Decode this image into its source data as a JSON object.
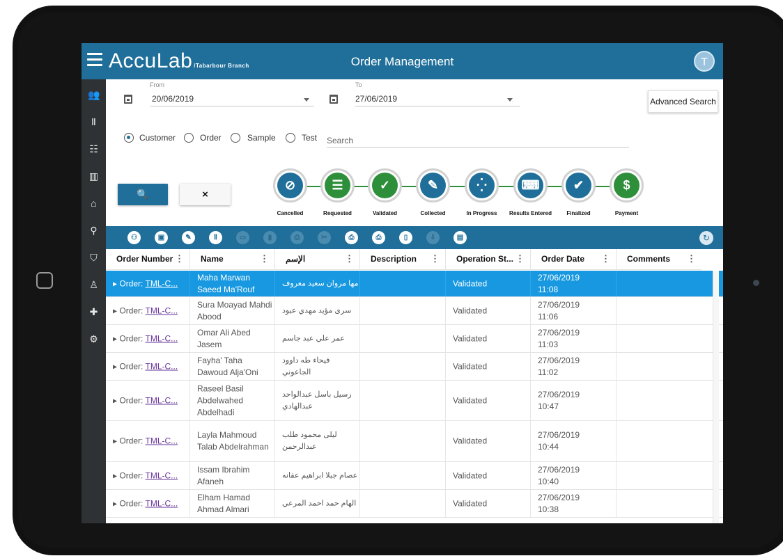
{
  "app": {
    "logo": "AccuLab",
    "branch": "/Tabarbour Branch",
    "title": "Order Management",
    "user_initial": "T"
  },
  "sidebar": {
    "items": [
      "users-icon",
      "tubes-icon",
      "list-icon",
      "chart-icon",
      "bank-icon",
      "microscope-icon",
      "shield-icon",
      "doctor-icon",
      "medkit-icon",
      "gear-icon"
    ]
  },
  "filters": {
    "from_label": "From",
    "from_value": "20/06/2019",
    "to_label": "To",
    "to_value": "27/06/2019",
    "advanced_search": "Advanced Search",
    "radio_options": [
      "Customer",
      "Order",
      "Sample",
      "Test"
    ],
    "selected_radio": "Customer",
    "search_placeholder": "Search",
    "search_button": "🔍",
    "clear_button": "×"
  },
  "statuses": [
    {
      "label": "Cancelled",
      "color": "#1f6f9a",
      "icon": "⊘"
    },
    {
      "label": "Requested",
      "color": "#2e8f3a",
      "icon": "☰"
    },
    {
      "label": "Validated",
      "color": "#2e8f3a",
      "icon": "✓"
    },
    {
      "label": "Collected",
      "color": "#1f6f9a",
      "icon": "✎"
    },
    {
      "label": "In Progress",
      "color": "#1f6f9a",
      "icon": "⁛"
    },
    {
      "label": "Results Entered",
      "color": "#1f6f9a",
      "icon": "⌨"
    },
    {
      "label": "Finalized",
      "color": "#1f6f9a",
      "icon": "✔"
    },
    {
      "label": "Payment",
      "color": "#2e8f3a",
      "icon": "$"
    }
  ],
  "table": {
    "columns": [
      "Order Number",
      "Name",
      "الإسم",
      "Description",
      "Operation St...",
      "Order Date",
      "Comments"
    ],
    "rows": [
      {
        "order_prefix": "Order:",
        "order_link": "TML-C...",
        "name": "Maha Marwan Saeed Ma'Rouf",
        "arabic": "مها مروان سعيد معروف",
        "description": "",
        "status": "Validated",
        "date": "27/06/2019",
        "time": "11:08",
        "comments": "",
        "selected": true
      },
      {
        "order_prefix": "Order:",
        "order_link": "TML-C...",
        "name": "Sura Moayad Mahdi Abood",
        "arabic": "سرى مؤيد مهدي عبود",
        "description": "",
        "status": "Validated",
        "date": "27/06/2019",
        "time": "11:06",
        "comments": "",
        "selected": false
      },
      {
        "order_prefix": "Order:",
        "order_link": "TML-C...",
        "name": "Omar Ali Abed Jasem",
        "arabic": "عمر علي عبد جاسم",
        "description": "",
        "status": "Validated",
        "date": "27/06/2019",
        "time": "11:03",
        "comments": "",
        "selected": false
      },
      {
        "order_prefix": "Order:",
        "order_link": "TML-C...",
        "name": "Fayha' Taha Dawoud Alja'Oni",
        "arabic": "فيحاء طه داوود الجاعوني",
        "description": "",
        "status": "Validated",
        "date": "27/06/2019",
        "time": "11:02",
        "comments": "",
        "selected": false
      },
      {
        "order_prefix": "Order:",
        "order_link": "TML-C...",
        "name": "Raseel Basil Abdelwahed Abdelhadi",
        "arabic": "رسيل باسل عبدالواحد عبدالهادي",
        "description": "",
        "status": "Validated",
        "date": "27/06/2019",
        "time": "10:47",
        "comments": "",
        "selected": false
      },
      {
        "order_prefix": "Order:",
        "order_link": "TML-C...",
        "name": "Layla Mahmoud Talab Abdelrahman",
        "arabic": "ليلى محمود طلب عبدالرحمن",
        "description": "",
        "status": "Validated",
        "date": "27/06/2019",
        "time": "10:44",
        "comments": "",
        "selected": false
      },
      {
        "order_prefix": "Order:",
        "order_link": "TML-C...",
        "name": "Issam Ibrahim Afaneh",
        "arabic": "عصام جبلا ابراهيم عفانه",
        "description": "",
        "status": "Validated",
        "date": "27/06/2019",
        "time": "10:40",
        "comments": "",
        "selected": false
      },
      {
        "order_prefix": "Order:",
        "order_link": "TML-C...",
        "name": "Elham Hamad Ahmad Almari",
        "arabic": "الهام حمد احمد المرعي",
        "description": "",
        "status": "Validated",
        "date": "27/06/2019",
        "time": "10:38",
        "comments": "",
        "selected": false
      }
    ]
  }
}
